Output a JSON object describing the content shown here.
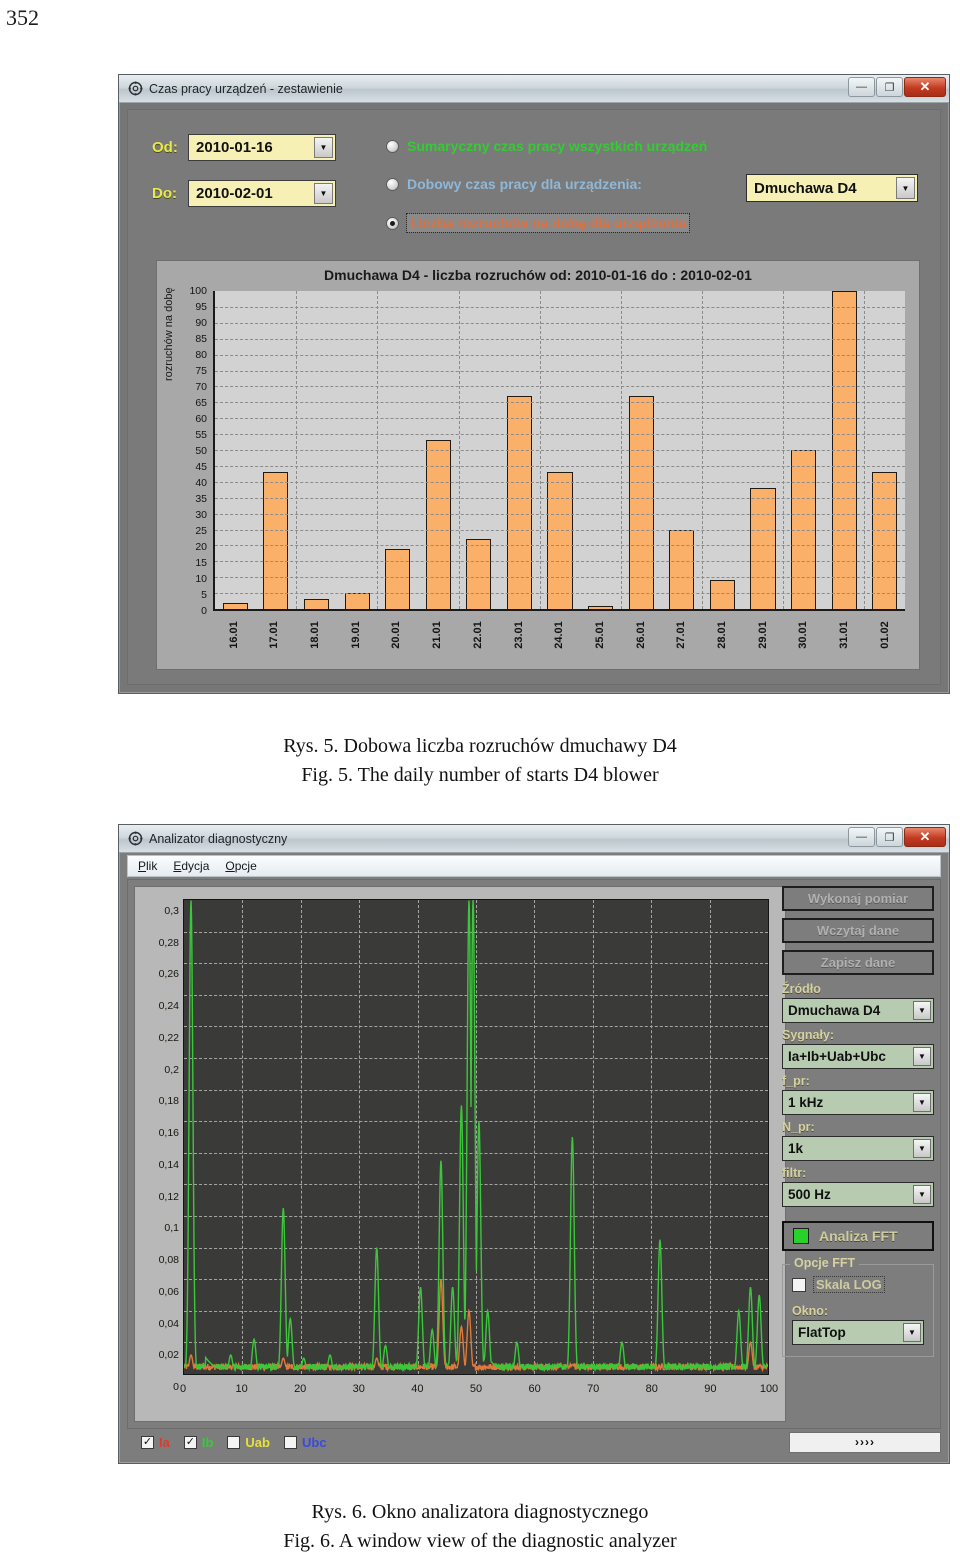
{
  "page": {
    "number": "352"
  },
  "window1": {
    "title": "Czas pracy urządzeń - zestawienie",
    "icon": "gear-icon",
    "buttons": {
      "minimize": "—",
      "maximize": "❐",
      "close": "✕"
    },
    "from_label": "Od:",
    "from_value": "2010-01-16",
    "to_label": "Do:",
    "to_value": "2010-02-01",
    "options": [
      {
        "label": "Sumaryczny czas pracy wszystkich urządzeń",
        "color": "#33cc33",
        "selected": false
      },
      {
        "label": "Dobowy czas pracy dla urządzenia:",
        "color": "#8fb8d8",
        "selected": false
      },
      {
        "label": "Liczba rozruchów na dobę dla urządzenia",
        "color": "#e0703c",
        "selected": true
      }
    ],
    "device_combo": "Dmuchawa D4"
  },
  "chart_data": {
    "type": "bar",
    "title": "Dmuchawa D4 - liczba rozruchów od: 2010-01-16 do : 2010-02-01",
    "xlabel": "",
    "ylabel": "rozruchów na dobę",
    "categories": [
      "16.01",
      "17.01",
      "18.01",
      "19.01",
      "20.01",
      "21.01",
      "22.01",
      "23.01",
      "24.01",
      "25.01",
      "26.01",
      "27.01",
      "28.01",
      "29.01",
      "30.01",
      "31.01",
      "01.02"
    ],
    "values": [
      2,
      43,
      3,
      5,
      19,
      53,
      22,
      67,
      43,
      1,
      67,
      25,
      9,
      38,
      50,
      100,
      43
    ],
    "ylim": [
      0,
      100
    ],
    "yticks": [
      0,
      5,
      10,
      15,
      20,
      25,
      30,
      35,
      40,
      45,
      50,
      55,
      60,
      65,
      70,
      75,
      80,
      85,
      90,
      95,
      100
    ],
    "grid": true,
    "bar_color": "#fbb06a",
    "plot_bg": "#d2d2d2",
    "legend": "none"
  },
  "caption1": {
    "line_pl": "Rys. 5. Dobowa liczba rozruchów dmuchawy D4",
    "line_en": "Fig. 5. The daily number of starts D4 blower"
  },
  "window2": {
    "title": "Analizator diagnostyczny",
    "icon": "gear-icon",
    "buttons": {
      "minimize": "—",
      "maximize": "❐",
      "close": "✕"
    },
    "menu": [
      "Plik",
      "Edycja",
      "Opcje"
    ],
    "actions": [
      "Wykonaj pomiar",
      "Wczytaj dane",
      "Zapisz dane"
    ],
    "fields": [
      {
        "label": "Źródło",
        "value": "Dmuchawa D4"
      },
      {
        "label": "Sygnały:",
        "value": "Ia+Ib+Uab+Ubc"
      },
      {
        "label": "f_pr:",
        "value": "1 kHz"
      },
      {
        "label": "N_pr:",
        "value": "1k"
      },
      {
        "label": "filtr:",
        "value": "500 Hz"
      }
    ],
    "fft_button": "Analiza FFT",
    "fft_led_color": "#29d12b",
    "fft_group_title": "Opcje FFT",
    "log_scale_label": "Skala LOG",
    "log_scale_checked": false,
    "window_label": "Okno:",
    "window_value": "FlatTop",
    "signals": [
      {
        "label": "Ia",
        "color": "#e03a2a",
        "checked": true
      },
      {
        "label": "Ib",
        "color": "#3ac83a",
        "checked": true
      },
      {
        "label": "Uab",
        "color": "#e8e03a",
        "checked": false
      },
      {
        "label": "Ubc",
        "color": "#3a4ae0",
        "checked": false
      }
    ],
    "next_button": "››››",
    "check_mark": "✓"
  },
  "fft_chart": {
    "type": "line",
    "title": "",
    "xlabel": "",
    "ylabel": "",
    "xlim": [
      0,
      100
    ],
    "ylim": [
      0,
      0.3
    ],
    "xticks": [
      0,
      10,
      20,
      30,
      40,
      50,
      60,
      70,
      80,
      90,
      100
    ],
    "yticks": [
      "0",
      "0,02",
      "0,04",
      "0,06",
      "0,08",
      "0,1",
      "0,12",
      "0,14",
      "0,16",
      "0,18",
      "0,2",
      "0,22",
      "0,24",
      "0,26",
      "0,28",
      "0,3"
    ],
    "plot_bg": "#3a3a38",
    "grid": true,
    "series": [
      {
        "name": "Ib",
        "color": "#3ac83a",
        "peaks": [
          [
            1.2,
            0.3
          ],
          [
            8.0,
            0.012
          ],
          [
            12.0,
            0.022
          ],
          [
            17.0,
            0.105
          ],
          [
            18.2,
            0.035
          ],
          [
            20.5,
            0.01
          ],
          [
            25.0,
            0.012
          ],
          [
            33.0,
            0.08
          ],
          [
            34.5,
            0.018
          ],
          [
            40.5,
            0.055
          ],
          [
            42.5,
            0.028
          ],
          [
            44.0,
            0.135
          ],
          [
            46.0,
            0.055
          ],
          [
            47.5,
            0.17
          ],
          [
            48.8,
            0.3
          ],
          [
            49.5,
            0.3
          ],
          [
            50.5,
            0.16
          ],
          [
            52.0,
            0.04
          ],
          [
            57.0,
            0.02
          ],
          [
            66.5,
            0.15
          ],
          [
            75.0,
            0.02
          ],
          [
            81.5,
            0.085
          ],
          [
            95.0,
            0.04
          ],
          [
            97.0,
            0.055
          ],
          [
            98.5,
            0.05
          ]
        ]
      },
      {
        "name": "Ia",
        "color": "#e07a3a",
        "peaks": [
          [
            1.2,
            0.012
          ],
          [
            17.0,
            0.01
          ],
          [
            33.0,
            0.01
          ],
          [
            44.0,
            0.06
          ],
          [
            47.5,
            0.03
          ],
          [
            48.8,
            0.04
          ],
          [
            66.5,
            0.006
          ],
          [
            97.0,
            0.02
          ]
        ]
      }
    ]
  },
  "caption2": {
    "line_pl": "Rys. 6. Okno analizatora diagnostycznego",
    "line_en": "Fig. 6. A window view of the diagnostic analyzer"
  }
}
